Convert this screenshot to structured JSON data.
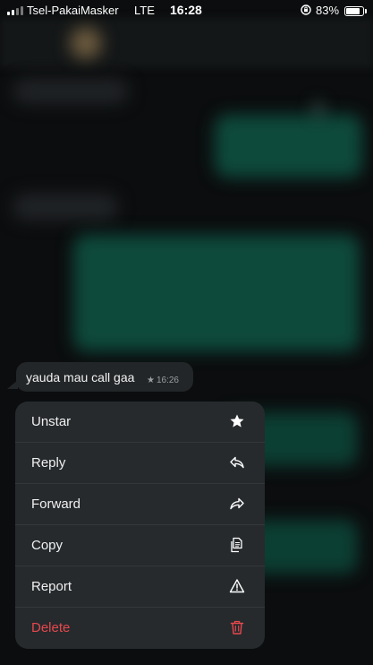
{
  "status_bar": {
    "carrier": "Tsel-PakaiMasker",
    "network": "LTE",
    "time": "16:28",
    "battery_percent": "83%",
    "battery_level": 0.83
  },
  "message": {
    "text": "yauda mau call gaa",
    "time": "16:26",
    "starred": true
  },
  "menu": {
    "items": [
      {
        "label": "Unstar",
        "icon": "star-icon"
      },
      {
        "label": "Reply",
        "icon": "reply-icon"
      },
      {
        "label": "Forward",
        "icon": "forward-icon"
      },
      {
        "label": "Copy",
        "icon": "copy-icon"
      },
      {
        "label": "Report",
        "icon": "warning-icon"
      },
      {
        "label": "Delete",
        "icon": "trash-icon"
      }
    ]
  },
  "colors": {
    "danger": "#e5484d",
    "menu_bg": "#262a2d",
    "bubble_bg": "#232628",
    "outgoing_bubble": "#0e4a3c"
  }
}
